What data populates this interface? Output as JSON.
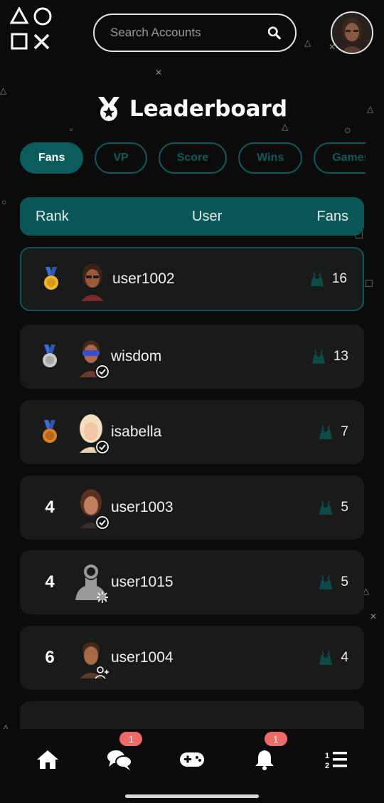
{
  "search": {
    "placeholder": "Search Accounts"
  },
  "page_title": "Leaderboard",
  "tabs": [
    {
      "label": "Fans",
      "active": true
    },
    {
      "label": "VP",
      "active": false
    },
    {
      "label": "Score",
      "active": false
    },
    {
      "label": "Wins",
      "active": false
    },
    {
      "label": "Games",
      "active": false
    }
  ],
  "table_header": {
    "rank": "Rank",
    "user": "User",
    "metric": "Fans"
  },
  "rows": [
    {
      "rank": "",
      "medal": "gold-medal-icon",
      "username": "user1002",
      "fans": "16",
      "badge": ""
    },
    {
      "rank": "",
      "medal": "silver-medal-icon",
      "username": "wisdom",
      "fans": "13",
      "badge": "verified-icon"
    },
    {
      "rank": "",
      "medal": "bronze-medal-icon",
      "username": "isabella",
      "fans": "7",
      "badge": "verified-icon"
    },
    {
      "rank": "4",
      "medal": "",
      "username": "user1003",
      "fans": "5",
      "badge": "verified-icon"
    },
    {
      "rank": "4",
      "medal": "",
      "username": "user1015",
      "fans": "5",
      "badge": "loading-icon"
    },
    {
      "rank": "6",
      "medal": "",
      "username": "user1004",
      "fans": "4",
      "badge": "add-friend-icon"
    }
  ],
  "nav": {
    "chat_badge": "1",
    "notifications_badge": "1"
  },
  "colors": {
    "accent": "#0d5c5c",
    "badge": "#f06a6a",
    "background": "#0b0b0b",
    "row": "#1a1a1a"
  }
}
